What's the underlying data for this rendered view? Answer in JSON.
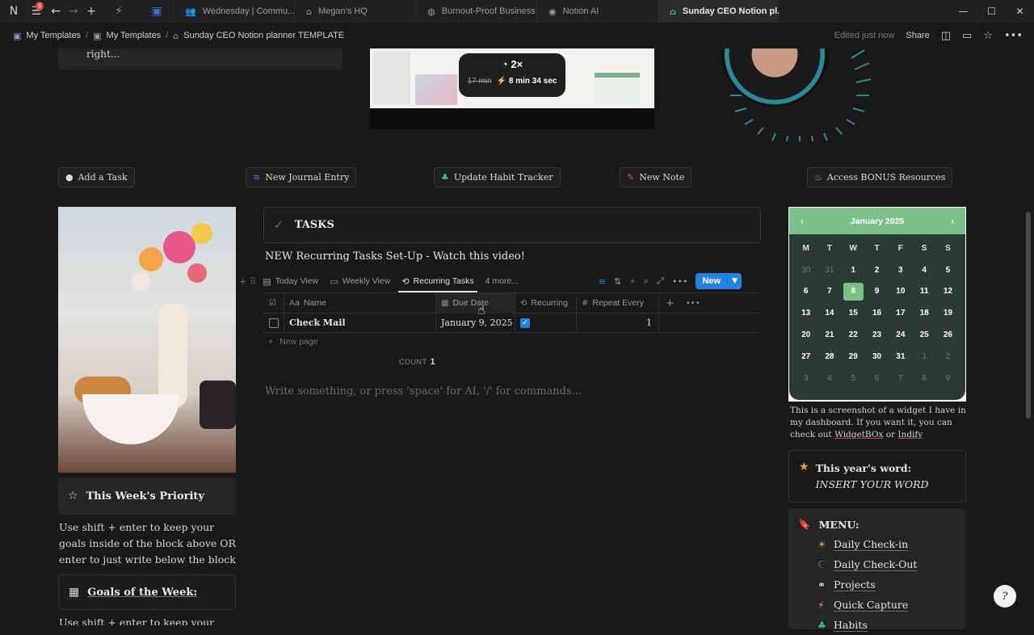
{
  "browser": {
    "notif_count": "6",
    "tabs": [
      {
        "label": "Wednesday | Commu...",
        "icon": "people-icon"
      },
      {
        "label": "Megan's HQ",
        "icon": "home-icon"
      },
      {
        "label": "Burnout-Proof Business",
        "icon": "globe-icon"
      },
      {
        "label": "Notion AI",
        "icon": "notion-ai-icon"
      },
      {
        "label": "Sunday CEO Notion pl...",
        "icon": "home-icon",
        "active": true
      }
    ]
  },
  "breadcrumb": {
    "items": [
      "My Templates",
      "My Templates",
      "Sunday CEO Notion planner TEMPLATE"
    ],
    "edited": "Edited just now",
    "share": "Share"
  },
  "top": {
    "quote_tail": "right...",
    "speed": "2×",
    "orig_time": "17 min",
    "new_time": "8 min 34 sec"
  },
  "actions": {
    "add_task": "Add a Task",
    "journal": "New Journal Entry",
    "habit": "Update Habit Tracker",
    "note": "New Note",
    "bonus": "Access BONUS Resources"
  },
  "left": {
    "priority_title": "This Week's Priority",
    "priority_text": "Use shift + enter to keep your goals inside of the block above OR enter to just write below the block",
    "goals_title": "Goals of the Week:",
    "goals_text": "Use shift + enter to keep your goals"
  },
  "tasks": {
    "title": "TASKS",
    "video_title": "NEW Recurring Tasks Set-Up - Watch this video!",
    "views": [
      "Today View",
      "Weekly View",
      "Recurring Tasks",
      "4 more..."
    ],
    "new_label": "New",
    "columns": [
      "Name",
      "Due Date",
      "Recurring",
      "Repeat Every"
    ],
    "rows": [
      {
        "name": "Check Mail",
        "due": "January 9, 2025",
        "recurring": true,
        "repeat": "1"
      }
    ],
    "new_page": "New page",
    "count_label": "COUNT",
    "count": "1",
    "placeholder": "Write something, or press 'space' for AI, '/' for commands..."
  },
  "calendar": {
    "month": "January 2025",
    "dow": [
      "M",
      "T",
      "W",
      "T",
      "F",
      "S",
      "S"
    ],
    "days": [
      {
        "d": "30",
        "m": true
      },
      {
        "d": "31",
        "m": true
      },
      {
        "d": "1"
      },
      {
        "d": "2"
      },
      {
        "d": "3"
      },
      {
        "d": "4"
      },
      {
        "d": "5"
      },
      {
        "d": "6"
      },
      {
        "d": "7"
      },
      {
        "d": "8",
        "t": true
      },
      {
        "d": "9"
      },
      {
        "d": "10"
      },
      {
        "d": "11"
      },
      {
        "d": "12"
      },
      {
        "d": "13"
      },
      {
        "d": "14"
      },
      {
        "d": "15"
      },
      {
        "d": "16"
      },
      {
        "d": "17"
      },
      {
        "d": "18"
      },
      {
        "d": "19"
      },
      {
        "d": "20"
      },
      {
        "d": "21"
      },
      {
        "d": "22"
      },
      {
        "d": "23"
      },
      {
        "d": "24"
      },
      {
        "d": "25"
      },
      {
        "d": "26"
      },
      {
        "d": "27"
      },
      {
        "d": "28"
      },
      {
        "d": "29"
      },
      {
        "d": "30"
      },
      {
        "d": "31"
      },
      {
        "d": "1",
        "m": true
      },
      {
        "d": "2",
        "m": true
      },
      {
        "d": "3",
        "m": true
      },
      {
        "d": "4",
        "m": true
      },
      {
        "d": "5",
        "m": true
      },
      {
        "d": "6",
        "m": true
      },
      {
        "d": "7",
        "m": true
      },
      {
        "d": "8",
        "m": true
      },
      {
        "d": "9",
        "m": true
      }
    ],
    "note_pre": "This is a screenshot of a widget I have in my dashboard. If you want it, you can check out ",
    "link1": "WidgetBOx",
    "note_or": " or ",
    "link2": "Indify"
  },
  "right": {
    "word_label": "This year's word:",
    "word_value": "INSERT YOUR WORD",
    "menu_title": "MENU:",
    "menu": [
      {
        "label": "Daily Check-in",
        "icon": "sunrise-icon"
      },
      {
        "label": "Daily Check-Out",
        "icon": "moon-icon"
      },
      {
        "label": "Projects",
        "icon": "link-icon"
      },
      {
        "label": "Quick Capture",
        "icon": "bolt-icon"
      },
      {
        "label": "Habits",
        "icon": "sprout-icon"
      }
    ]
  },
  "colors": {
    "accent": "#2383e2",
    "calendar_green": "#7cc18a",
    "calendar_bg": "#2b3a35",
    "bg": "#191919"
  }
}
